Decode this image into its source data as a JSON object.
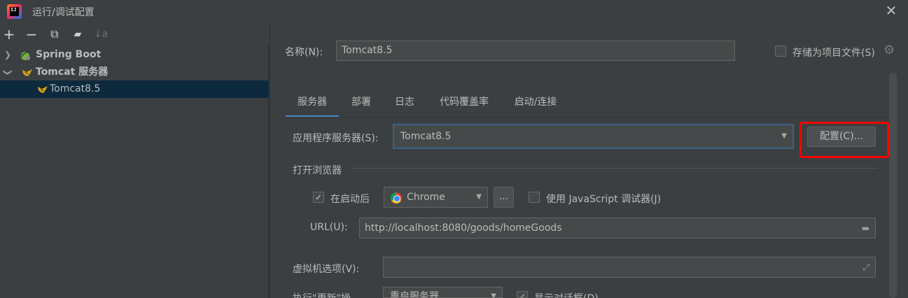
{
  "window": {
    "title": "运行/调试配置",
    "app_icon_text": "IJ",
    "close": "✕"
  },
  "toolbar": {
    "add": "+",
    "remove": "−",
    "copy": "⧉",
    "folder": "▰",
    "sort": "↓a"
  },
  "tree": {
    "items": [
      {
        "label": "Spring Boot",
        "expanded": false
      },
      {
        "label": "Tomcat 服务器",
        "expanded": true
      },
      {
        "label": "Tomcat8.5",
        "selected": true
      }
    ]
  },
  "config": {
    "name_label": "名称(N):",
    "name_value": "Tomcat8.5",
    "store_label": "存储为项目文件(S)",
    "store_checked": false
  },
  "tabs": [
    "服务器",
    "部署",
    "日志",
    "代码覆盖率",
    "启动/连接"
  ],
  "active_tab": 0,
  "server": {
    "app_server_label": "应用程序服务器(S):",
    "app_server_value": "Tomcat8.5",
    "configure_button": "配置(C)...",
    "open_browser_label": "打开浏览器",
    "after_launch_label": "在启动后",
    "after_launch_checked": true,
    "browser_value": "Chrome",
    "browse_button": "...",
    "js_debugger_label": "使用 JavaScript 调试器(J)",
    "js_debugger_checked": false,
    "url_label": "URL(U):",
    "url_value": "http://localhost:8080/goods/homeGoods",
    "vm_options_label": "虚拟机选项(V):",
    "vm_options_value": "",
    "on_update_label": "执行\"更新\"操",
    "on_update_value": "重启服务器",
    "show_dialog_label": "显示对话框(D)",
    "show_dialog_checked": true
  },
  "colors": {
    "background": "#3c3f41",
    "selection": "#0d293e",
    "tab_underline": "#4a88c7",
    "highlight": "#ff0000"
  }
}
